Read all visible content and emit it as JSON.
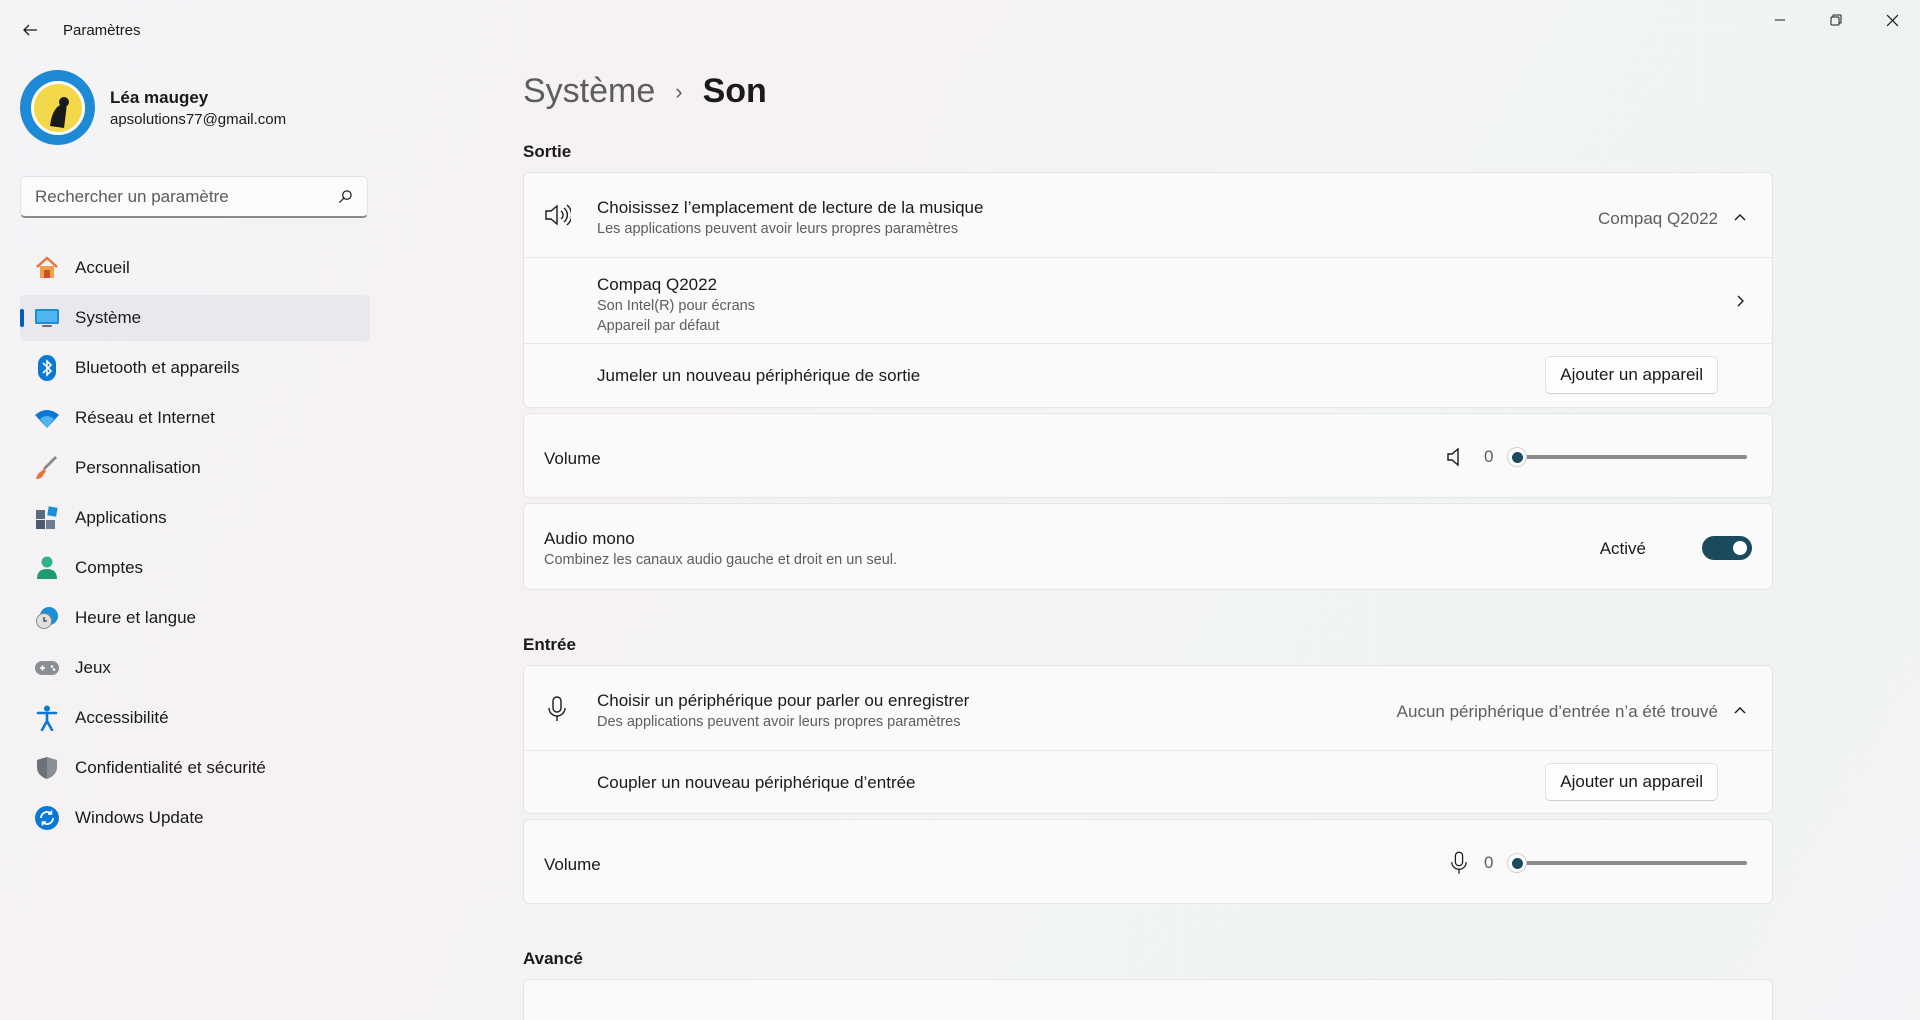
{
  "app": {
    "title": "Paramètres"
  },
  "user": {
    "name": "Léa maugey",
    "email": "apsolutions77@gmail.com"
  },
  "search": {
    "placeholder": "Rechercher un paramètre"
  },
  "nav": {
    "items": [
      {
        "label": "Accueil",
        "icon": "home-icon",
        "active": false
      },
      {
        "label": "Système",
        "icon": "system-icon",
        "active": true
      },
      {
        "label": "Bluetooth et appareils",
        "icon": "bluetooth-icon",
        "active": false
      },
      {
        "label": "Réseau et Internet",
        "icon": "wifi-icon",
        "active": false
      },
      {
        "label": "Personnalisation",
        "icon": "brush-icon",
        "active": false
      },
      {
        "label": "Applications",
        "icon": "apps-icon",
        "active": false
      },
      {
        "label": "Comptes",
        "icon": "account-icon",
        "active": false
      },
      {
        "label": "Heure et langue",
        "icon": "time-language-icon",
        "active": false
      },
      {
        "label": "Jeux",
        "icon": "gamepad-icon",
        "active": false
      },
      {
        "label": "Accessibilité",
        "icon": "accessibility-icon",
        "active": false
      },
      {
        "label": "Confidentialité et sécurité",
        "icon": "shield-icon",
        "active": false
      },
      {
        "label": "Windows Update",
        "icon": "windows-update-icon",
        "active": false
      }
    ]
  },
  "breadcrumb": {
    "parent": "Système",
    "separator": "›",
    "current": "Son"
  },
  "output": {
    "section_title": "Sortie",
    "choose": {
      "title": "Choisissez l’emplacement de lecture de la musique",
      "subtitle": "Les applications peuvent avoir leurs propres paramètres",
      "value": "Compaq Q2022"
    },
    "device": {
      "name": "Compaq Q2022",
      "line1": "Son Intel(R) pour écrans",
      "line2": "Appareil par défaut"
    },
    "pair": {
      "label": "Jumeler un nouveau périphérique de sortie",
      "button": "Ajouter un appareil"
    },
    "volume": {
      "label": "Volume",
      "value": "0",
      "level": 0
    },
    "mono": {
      "title": "Audio mono",
      "subtitle": "Combinez les canaux audio gauche et droit en un seul.",
      "state": "Activé",
      "on": true
    }
  },
  "input": {
    "section_title": "Entrée",
    "choose": {
      "title": "Choisir un périphérique pour parler ou enregistrer",
      "subtitle": "Des applications peuvent avoir leurs propres paramètres",
      "value": "Aucun périphérique d’entrée n’a été trouvé"
    },
    "pair": {
      "label": "Coupler un nouveau périphérique d’entrée",
      "button": "Ajouter un appareil"
    },
    "volume": {
      "label": "Volume",
      "value": "0",
      "level": 0
    }
  },
  "advanced": {
    "section_title": "Avancé"
  },
  "colors": {
    "accent": "#005fb8",
    "toggle_on": "#1a4a5e",
    "avatar_bg": "#1e8ad6"
  }
}
